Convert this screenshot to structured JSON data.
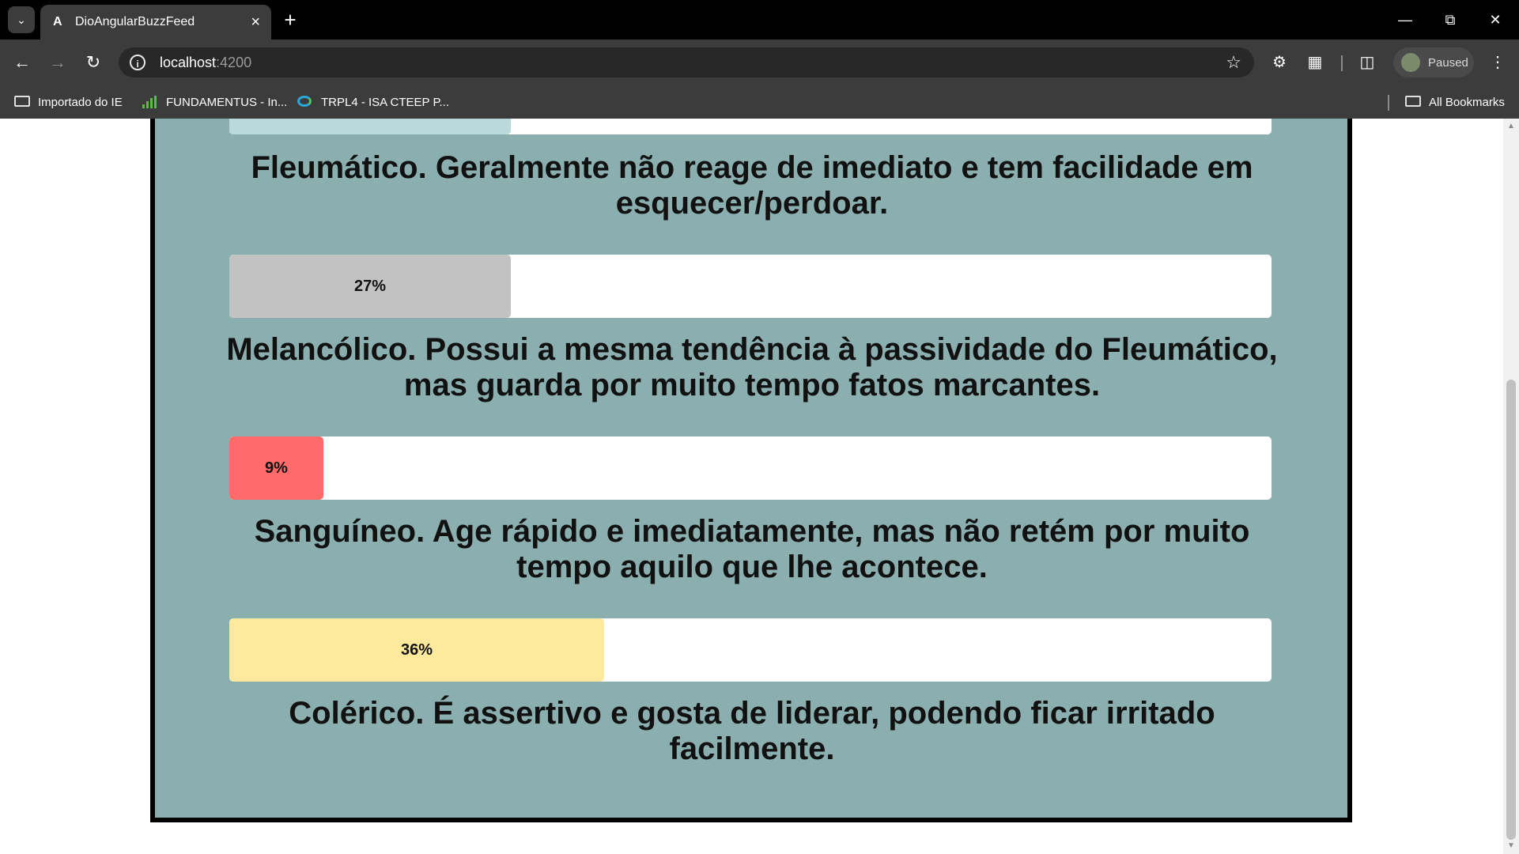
{
  "browser": {
    "tab_title": "DioAngularBuzzFeed",
    "tab_favicon": "A",
    "url_host": "localhost",
    "url_port": ":4200",
    "profile_label": "Paused",
    "bookmarks": [
      {
        "label": "Importado do IE",
        "icon": "folder-icon"
      },
      {
        "label": "FUNDAMENTUS - In...",
        "icon": "signal-bars-icon"
      },
      {
        "label": "TRPL4 - ISA CTEEP P...",
        "icon": "edge-icon"
      }
    ],
    "all_bookmarks_label": "All Bookmarks"
  },
  "results": [
    {
      "percent": 27,
      "percent_label": "",
      "color": "#b9d9da",
      "text": ""
    },
    {
      "percent": 27,
      "percent_label": "27%",
      "color": "#c2c2c2",
      "text": "Fleumático. Geralmente não reage de imediato e tem facilidade em esquecer/perdoar."
    },
    {
      "percent": 9,
      "percent_label": "9%",
      "color": "#ff6b6b",
      "text": "Melancólico. Possui a mesma tendência à passividade do Fleumático, mas guarda por muito tempo fatos marcantes."
    },
    {
      "percent": 36,
      "percent_label": "36%",
      "color": "#ffe99c",
      "text": "Sanguíneo. Age rápido e imediatamente, mas não retém por muito tempo aquilo que lhe acontece."
    }
  ],
  "last_text": "Colérico. É assertivo e gosta de liderar, podendo ficar irritado facilmente."
}
